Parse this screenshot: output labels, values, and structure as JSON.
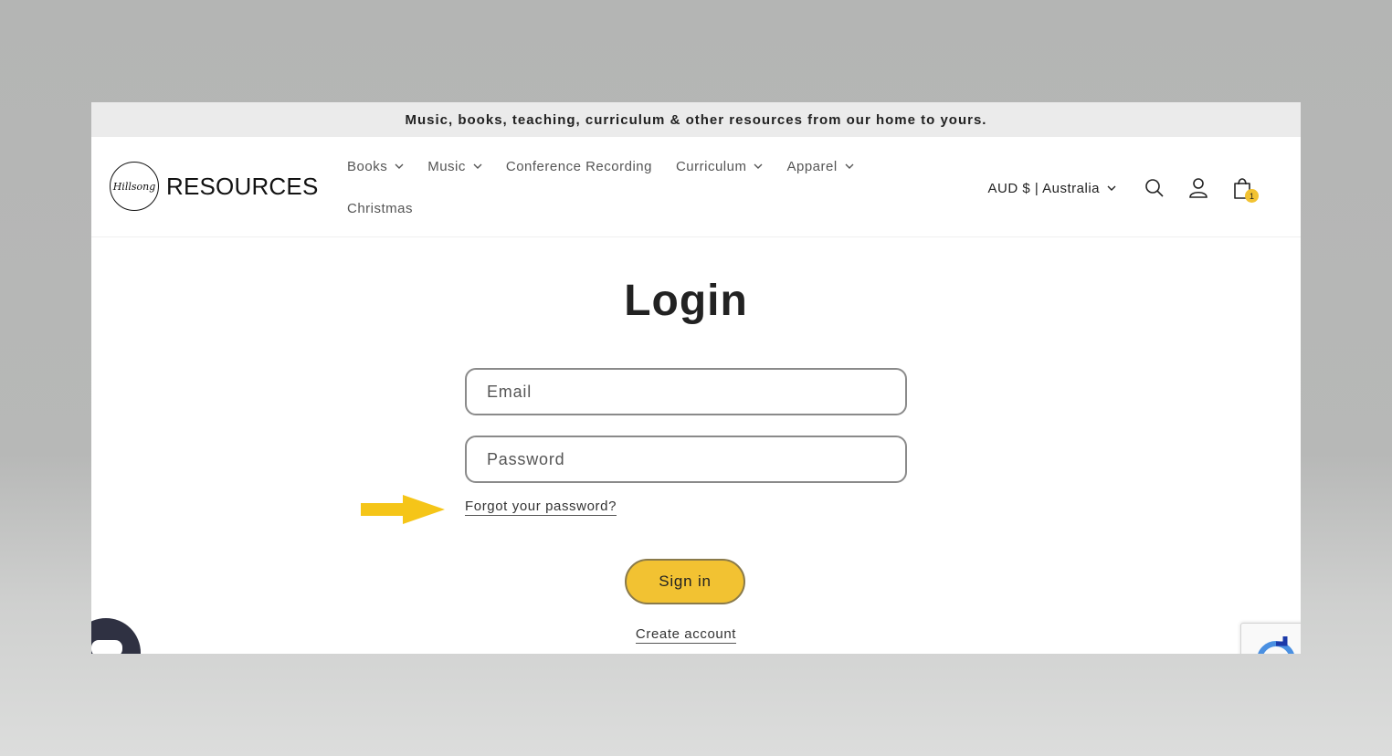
{
  "announcement": "Music, books, teaching, curriculum & other resources from our home to yours.",
  "logo": {
    "script": "Hillsong",
    "text": "RESOURCES"
  },
  "nav": {
    "row1": [
      {
        "label": "Books",
        "dropdown": true
      },
      {
        "label": "Music",
        "dropdown": true
      },
      {
        "label": "Conference Recording",
        "dropdown": false
      },
      {
        "label": "Curriculum",
        "dropdown": true
      },
      {
        "label": "Apparel",
        "dropdown": true
      }
    ],
    "row2": [
      {
        "label": "Christmas",
        "dropdown": false
      }
    ]
  },
  "header": {
    "currency": "AUD $ | Australia",
    "cart_count": "1"
  },
  "login": {
    "title": "Login",
    "email_placeholder": "Email",
    "password_placeholder": "Password",
    "forgot_link": "Forgot your password?",
    "sign_in": "Sign in",
    "create_account": "Create account"
  },
  "colors": {
    "accent": "#f2c232",
    "annotation_arrow": "#f5c518",
    "chat": "#2f3142"
  }
}
